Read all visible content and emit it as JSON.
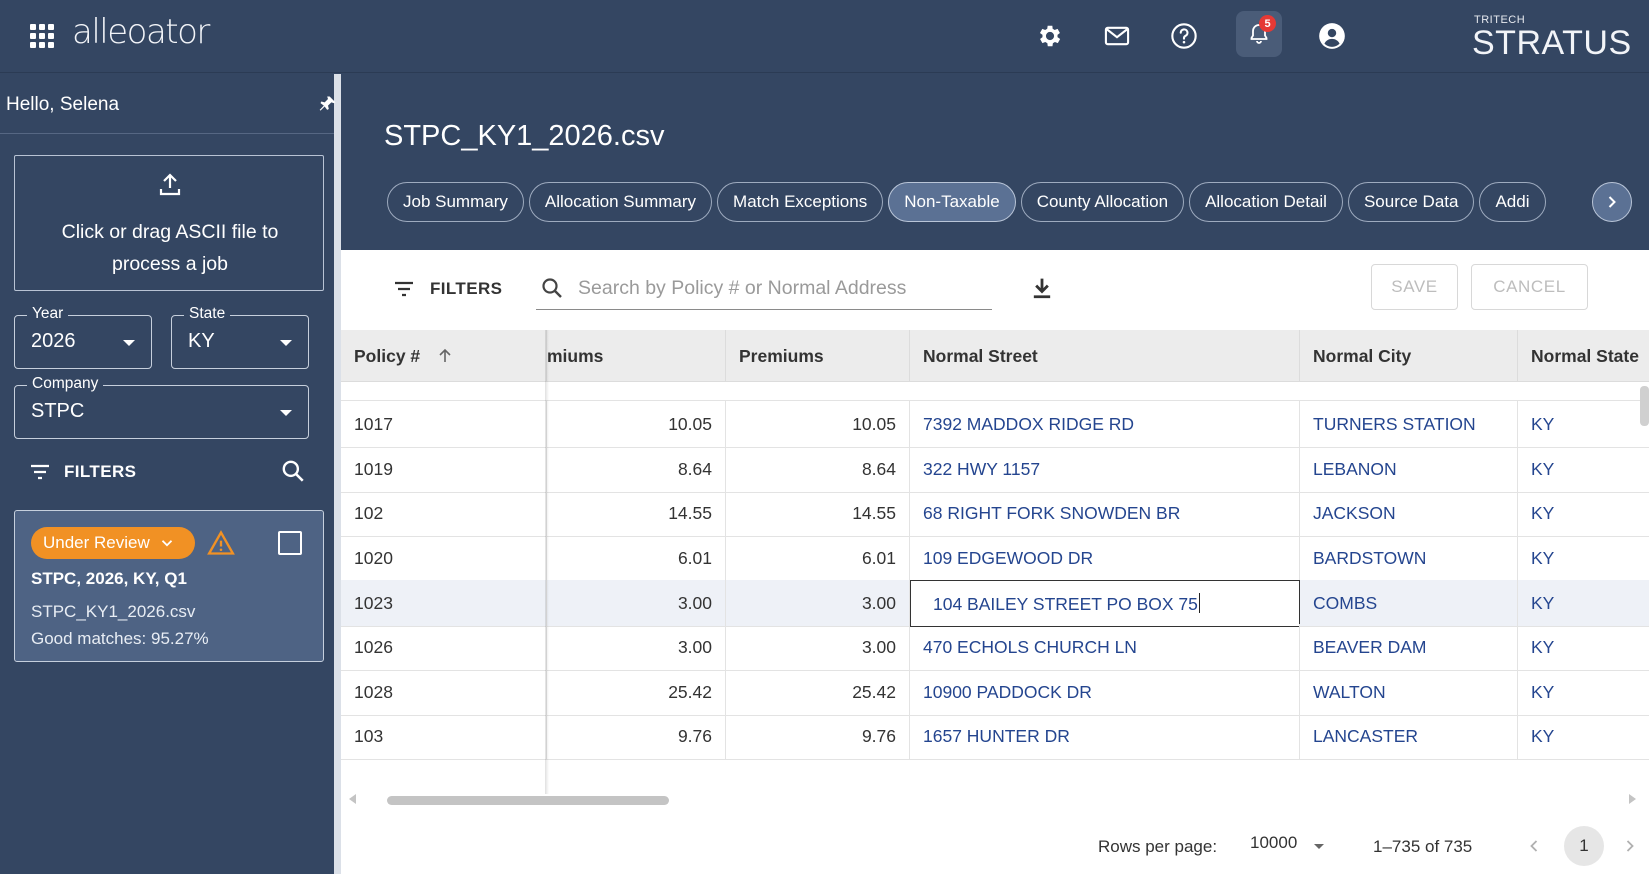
{
  "app": {
    "logo_text": "alleoator",
    "brand_small": "TRITECH",
    "brand_big": "STRATUS",
    "notification_count": "5"
  },
  "sidebar": {
    "greeting": "Hello, Selena",
    "upload_text": "Click or drag ASCII file to process a job",
    "year": {
      "label": "Year",
      "value": "2026"
    },
    "state": {
      "label": "State",
      "value": "KY"
    },
    "company": {
      "label": "Company",
      "value": "STPC"
    },
    "filters_label": "FILTERS",
    "job_card": {
      "status": "Under Review",
      "title": "STPC, 2026, KY, Q1",
      "file": "STPC_KY1_2026.csv",
      "match_text": "Good matches: 95.27%"
    }
  },
  "main": {
    "title": "STPC_KY1_2026.csv",
    "tabs": [
      {
        "label": "Job Summary",
        "active": false
      },
      {
        "label": "Allocation Summary",
        "active": false
      },
      {
        "label": "Match Exceptions",
        "active": false
      },
      {
        "label": "Non-Taxable",
        "active": true
      },
      {
        "label": "County Allocation",
        "active": false
      },
      {
        "label": "Allocation Detail",
        "active": false
      },
      {
        "label": "Source Data",
        "active": false
      },
      {
        "label": "Addi",
        "active": false
      }
    ],
    "toolbar": {
      "filters_label": "FILTERS",
      "search_placeholder": "Search by Policy # or Normal Address",
      "save_label": "SAVE",
      "cancel_label": "CANCEL"
    },
    "table": {
      "columns": [
        "Policy #",
        "miums",
        "Premiums",
        "Normal Street",
        "Normal City",
        "Normal State"
      ],
      "rows": [
        {
          "policy": "1017",
          "gross": "10.05",
          "premiums": "10.05",
          "street": "7392 MADDOX RIDGE RD",
          "city": "TURNERS STATION",
          "state": "KY"
        },
        {
          "policy": "1019",
          "gross": "8.64",
          "premiums": "8.64",
          "street": "322 HWY 1157",
          "city": "LEBANON",
          "state": "KY"
        },
        {
          "policy": "102",
          "gross": "14.55",
          "premiums": "14.55",
          "street": "68 RIGHT FORK SNOWDEN BR",
          "city": "JACKSON",
          "state": "KY"
        },
        {
          "policy": "1020",
          "gross": "6.01",
          "premiums": "6.01",
          "street": "109 EDGEWOOD DR",
          "city": "BARDSTOWN",
          "state": "KY"
        },
        {
          "policy": "1023",
          "gross": "3.00",
          "premiums": "3.00",
          "street": "104 BAILEY STREET PO BOX 75",
          "city": "COMBS",
          "state": "KY",
          "editing": true
        },
        {
          "policy": "1026",
          "gross": "3.00",
          "premiums": "3.00",
          "street": "470 ECHOLS CHURCH LN",
          "city": "BEAVER DAM",
          "state": "KY"
        },
        {
          "policy": "1028",
          "gross": "25.42",
          "premiums": "25.42",
          "street": "10900 PADDOCK DR",
          "city": "WALTON",
          "state": "KY"
        },
        {
          "policy": "103",
          "gross": "9.76",
          "premiums": "9.76",
          "street": "1657 HUNTER DR",
          "city": "LANCASTER",
          "state": "KY"
        }
      ]
    },
    "pagination": {
      "rows_per_page_label": "Rows per page:",
      "rows_per_page": "10000",
      "range": "1–735 of 735",
      "page": "1"
    }
  },
  "colors": {
    "header_bg": "#344662",
    "status_chip": "#f19124",
    "link": "#24458f",
    "badge": "#e53935"
  }
}
